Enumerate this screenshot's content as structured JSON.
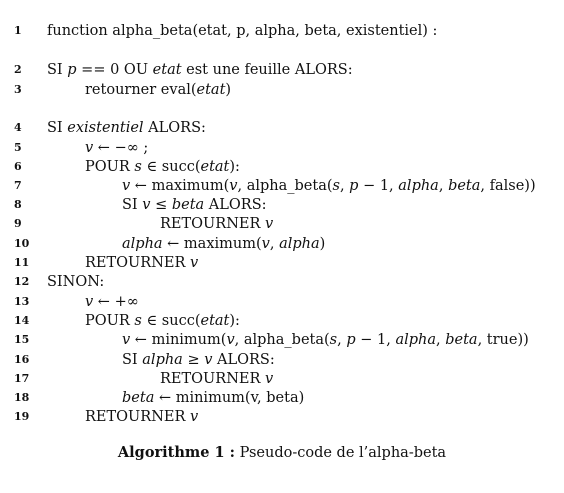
{
  "algorithm": {
    "lines": [
      {
        "n": "1",
        "indent": 0,
        "html": "function alpha_beta(etat, p, alpha, beta, existentiel) :"
      },
      {
        "n": "2",
        "indent": 0,
        "html": "SI <i>p</i> == 0 OU <i>etat</i> est une feuille ALORS:"
      },
      {
        "n": "3",
        "indent": 1,
        "html": "retourner eval(<i>etat</i>)"
      },
      {
        "n": "4",
        "indent": 0,
        "html": "SI <i>existentiel</i> ALORS:"
      },
      {
        "n": "5",
        "indent": 1,
        "html": "<i>v</i> ← −∞ ;"
      },
      {
        "n": "6",
        "indent": 1,
        "html": "POUR <i>s</i> ∈ succ(<i>etat</i>):"
      },
      {
        "n": "7",
        "indent": 2,
        "html": "<i>v</i> ← maximum(<i>v</i>, alpha_beta(<i>s</i>, <i>p</i> − 1, <i>alpha</i>, <i>beta</i>, false))"
      },
      {
        "n": "8",
        "indent": 2,
        "html": "SI <i>v</i> ≤ <i>beta</i> ALORS:"
      },
      {
        "n": "9",
        "indent": 3,
        "html": "RETOURNER <i>v</i>"
      },
      {
        "n": "10",
        "indent": 2,
        "html": "<i>alpha</i> ← maximum(<i>v</i>, <i>alpha</i>)"
      },
      {
        "n": "11",
        "indent": 1,
        "html": "RETOURNER <i>v</i>"
      },
      {
        "n": "12",
        "indent": 0,
        "html": "SINON:"
      },
      {
        "n": "13",
        "indent": 1,
        "html": "<i>v</i> ← +∞"
      },
      {
        "n": "14",
        "indent": 1,
        "html": "POUR <i>s</i> ∈ succ(<i>etat</i>):"
      },
      {
        "n": "15",
        "indent": 2,
        "html": "<i>v</i> ← minimum(<i>v</i>, alpha_beta(<i>s</i>, <i>p</i> − 1, <i>alpha</i>, <i>beta</i>, true))"
      },
      {
        "n": "16",
        "indent": 2,
        "html": "SI <i>alpha</i> ≥ <i>v</i> ALORS:"
      },
      {
        "n": "17",
        "indent": 3,
        "html": "RETOURNER <i>v</i>"
      },
      {
        "n": "18",
        "indent": 2,
        "html": "<i>beta</i> ← minimum(v, beta)"
      },
      {
        "n": "19",
        "indent": 1,
        "html": "RETOURNER <i>v</i>"
      }
    ]
  },
  "caption": {
    "label": "Algorithme 1 :",
    "text": "Pseudo-code de l’alpha-beta"
  }
}
